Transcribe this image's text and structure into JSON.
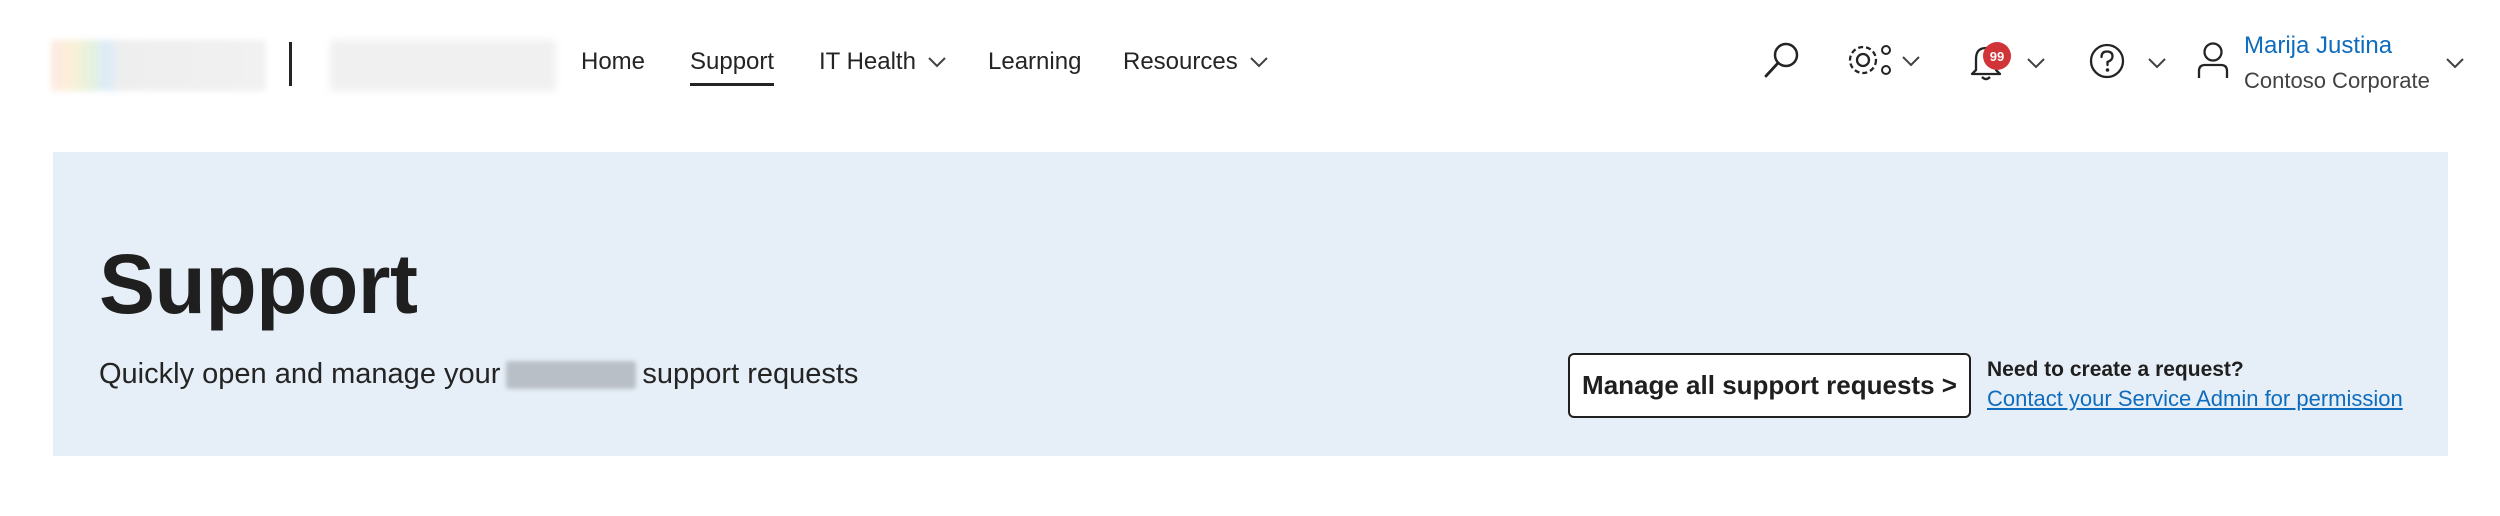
{
  "header": {
    "nav": [
      {
        "label": "Home",
        "active": false,
        "has_dropdown": false
      },
      {
        "label": "Support",
        "active": true,
        "has_dropdown": false
      },
      {
        "label": "IT Health",
        "active": false,
        "has_dropdown": true
      },
      {
        "label": "Learning",
        "active": false,
        "has_dropdown": false
      },
      {
        "label": "Resources",
        "active": false,
        "has_dropdown": true
      }
    ],
    "icons": [
      "search-icon",
      "settings-icon",
      "bell-icon",
      "help-icon",
      "person-icon"
    ],
    "notifications_count": "99",
    "user": {
      "name": "Marija Justina",
      "org": "Contoso Corporate"
    }
  },
  "hero": {
    "title": "Support",
    "subtitle_before": "Quickly open and manage your",
    "subtitle_after": "support requests",
    "manage_button": "Manage all support requests >",
    "need_request": "Need to create a request?",
    "contact_link": "Contact your Service Admin for permission"
  },
  "colors": {
    "accent": "#0f6cbd",
    "hero_bg": "#e6eff7",
    "badge": "#d13438",
    "text": "#242424"
  }
}
